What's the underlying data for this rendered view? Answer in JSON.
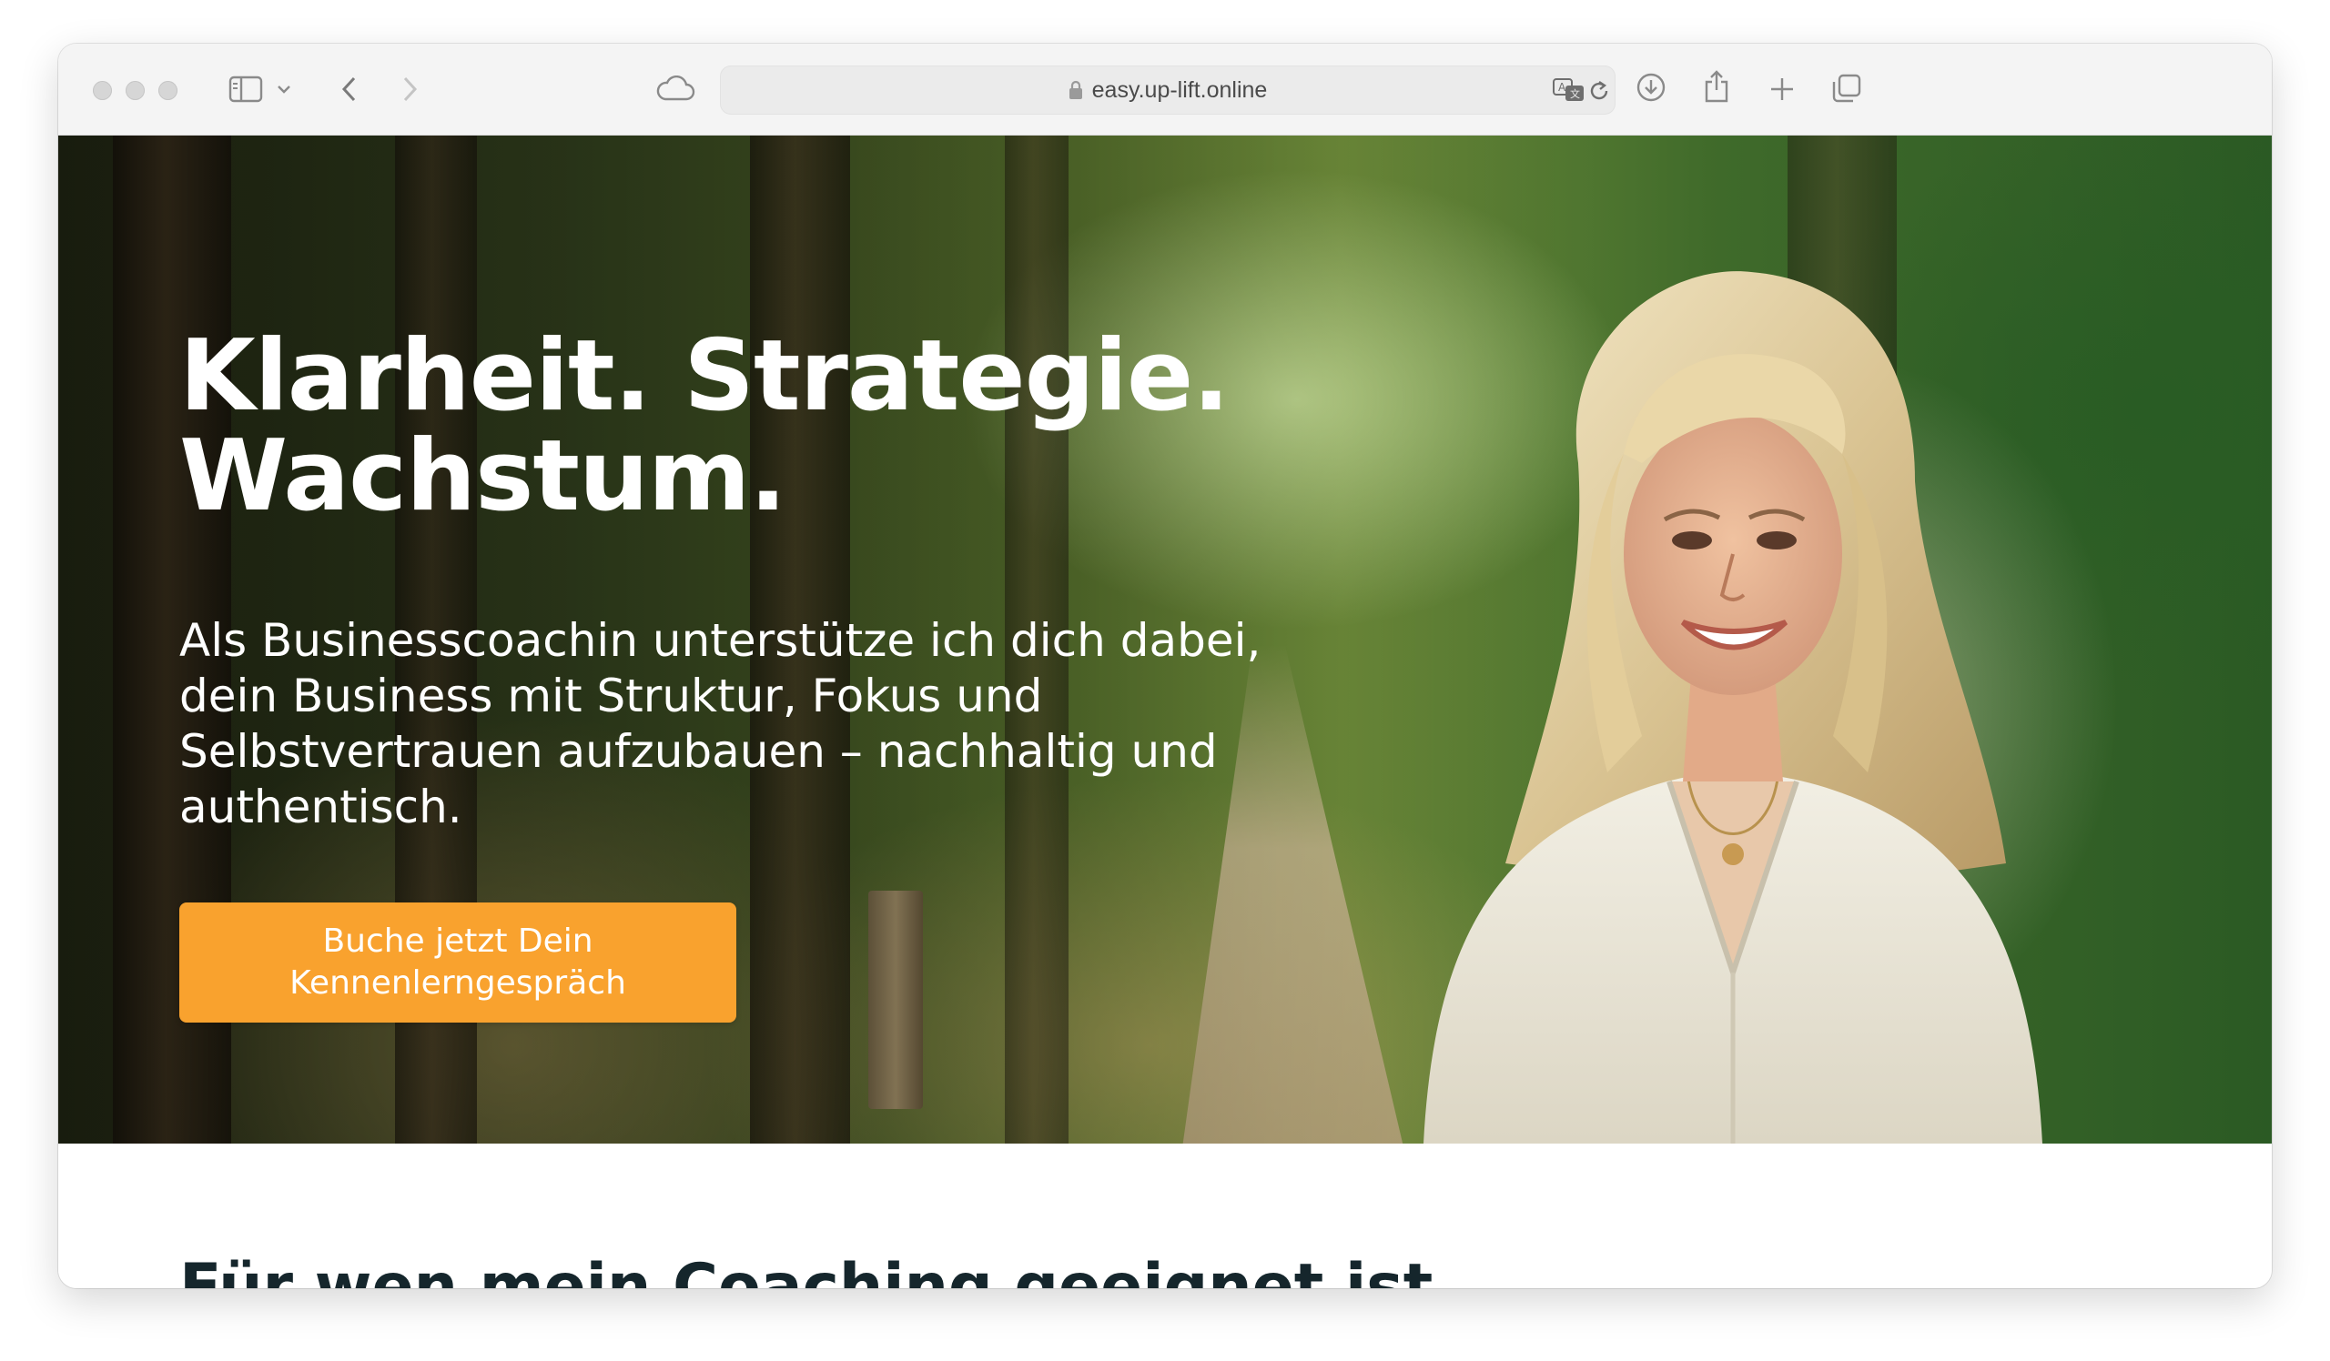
{
  "browser": {
    "url": "easy.up-lift.online",
    "icons": {
      "sidebar": "sidebar-icon",
      "back": "chevron-left-icon",
      "forward": "chevron-right-icon",
      "cloud": "cloud-icon",
      "translate": "translate-icon",
      "reload": "reload-icon",
      "download": "download-icon",
      "share": "share-icon",
      "new_tab": "plus-icon",
      "tabs": "tab-overview-icon"
    }
  },
  "hero": {
    "headline_line1": "Klarheit. Strategie.",
    "headline_line2": "Wachstum.",
    "subtext": "Als Businesscoachin unterstütze ich dich dabei, dein Business mit Struktur, Fokus und Selbstvertrauen aufzubauen – nachhaltig und authentisch.",
    "cta_label": "Buche jetzt Dein Kennenlerngespräch",
    "cta_color": "#f9a22e"
  },
  "section": {
    "title": "Für wen mein Coaching geeignet ist"
  }
}
